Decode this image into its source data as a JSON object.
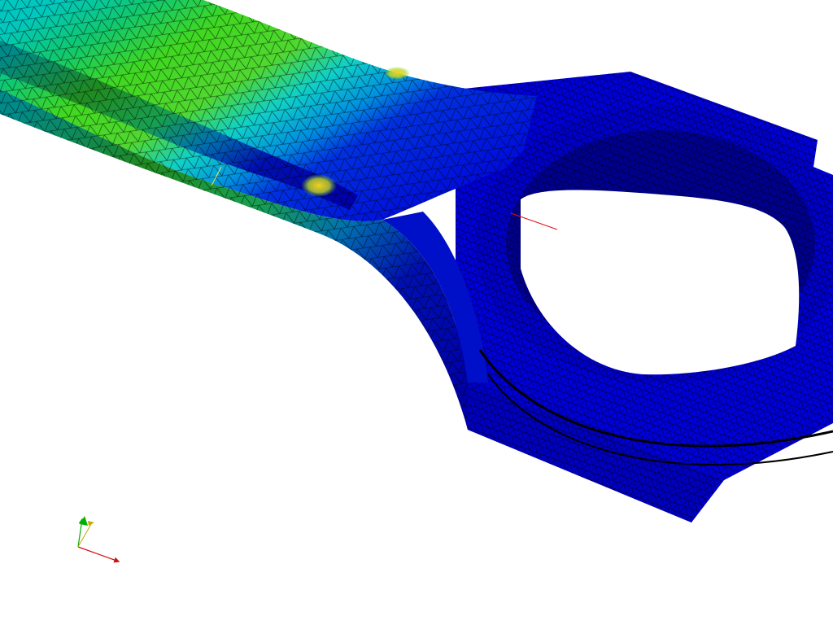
{
  "viewport": {
    "background": "#ffffff",
    "model": "connecting-rod-fea-mesh",
    "colormap": [
      "#0000e0",
      "#0070e0",
      "#00d8d8",
      "#00d040",
      "#60e020",
      "#e8e030",
      "#e09020"
    ],
    "mesh_line_color": "#000000",
    "hotspot_color": "#e8c020",
    "interactive_rotate": true
  },
  "axis_triad": {
    "x_color": "#d01010",
    "y_color": "#00b000",
    "z_color": "#c8a800"
  },
  "icons": {
    "triad": "axis-triad-icon",
    "center": "rotation-center-marker"
  }
}
